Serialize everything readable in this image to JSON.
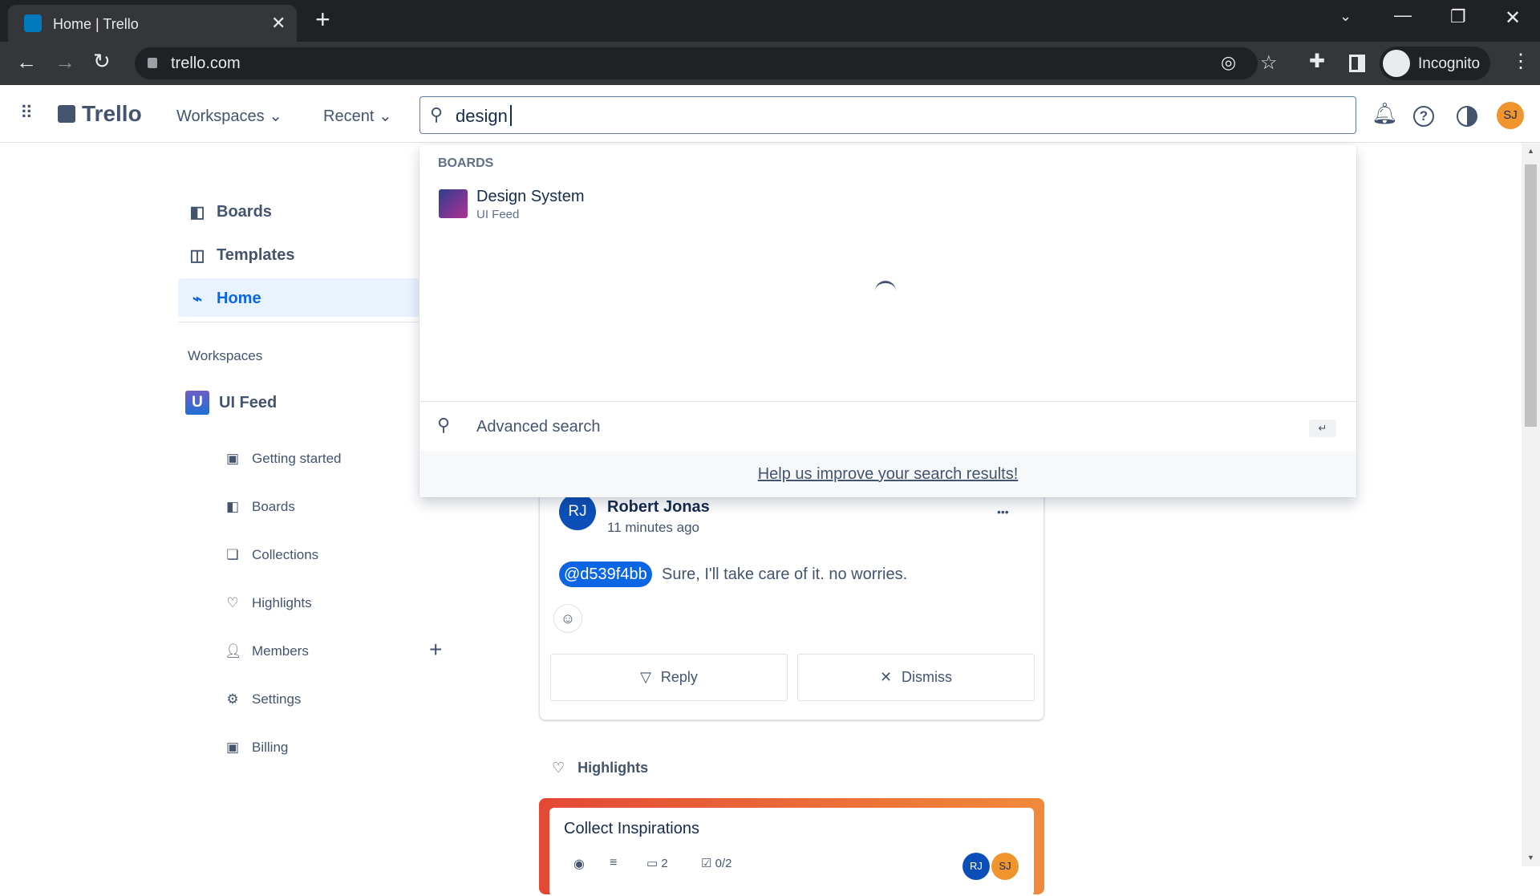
{
  "browser": {
    "tab_title": "Home | Trello",
    "url": "trello.com",
    "profile": "Incognito"
  },
  "header": {
    "logo": "Trello",
    "workspaces": "Workspaces",
    "recent": "Recent",
    "search_value": "design",
    "avatar": "SJ"
  },
  "search_dropdown": {
    "section": "BOARDS",
    "results": [
      {
        "title": "Design System",
        "subtitle": "UI Feed"
      }
    ],
    "advanced": "Advanced search",
    "enter_hint": "↵",
    "feedback": "Help us improve your search results!"
  },
  "sidebar": {
    "main": [
      {
        "label": "Boards",
        "icon": "board-icon"
      },
      {
        "label": "Templates",
        "icon": "template-icon"
      },
      {
        "label": "Home",
        "icon": "activity-icon"
      }
    ],
    "workspaces_label": "Workspaces",
    "workspace": {
      "badge": "U",
      "name": "UI Feed"
    },
    "sub": [
      {
        "label": "Getting started"
      },
      {
        "label": "Boards"
      },
      {
        "label": "Collections"
      },
      {
        "label": "Highlights"
      },
      {
        "label": "Members"
      },
      {
        "label": "Settings"
      },
      {
        "label": "Billing"
      }
    ],
    "add": "+"
  },
  "comment": {
    "avatar": "RJ",
    "author": "Robert Jonas",
    "time": "11 minutes ago",
    "mention": "@d539f4bb",
    "text": "Sure, I'll take care of it. no worries.",
    "more": "•••",
    "reply": "Reply",
    "dismiss": "Dismiss"
  },
  "highlights": {
    "label": "Highlights",
    "card_title": "Collect Inspirations",
    "comments": "2",
    "checklist": "0/2",
    "members": [
      "RJ",
      "SJ"
    ]
  },
  "colors": {
    "accent": "#0c66e4",
    "active_bg": "#e9f2ff",
    "avatar_sj": "#f0952e",
    "avatar_rj": "#0c4fb8"
  }
}
